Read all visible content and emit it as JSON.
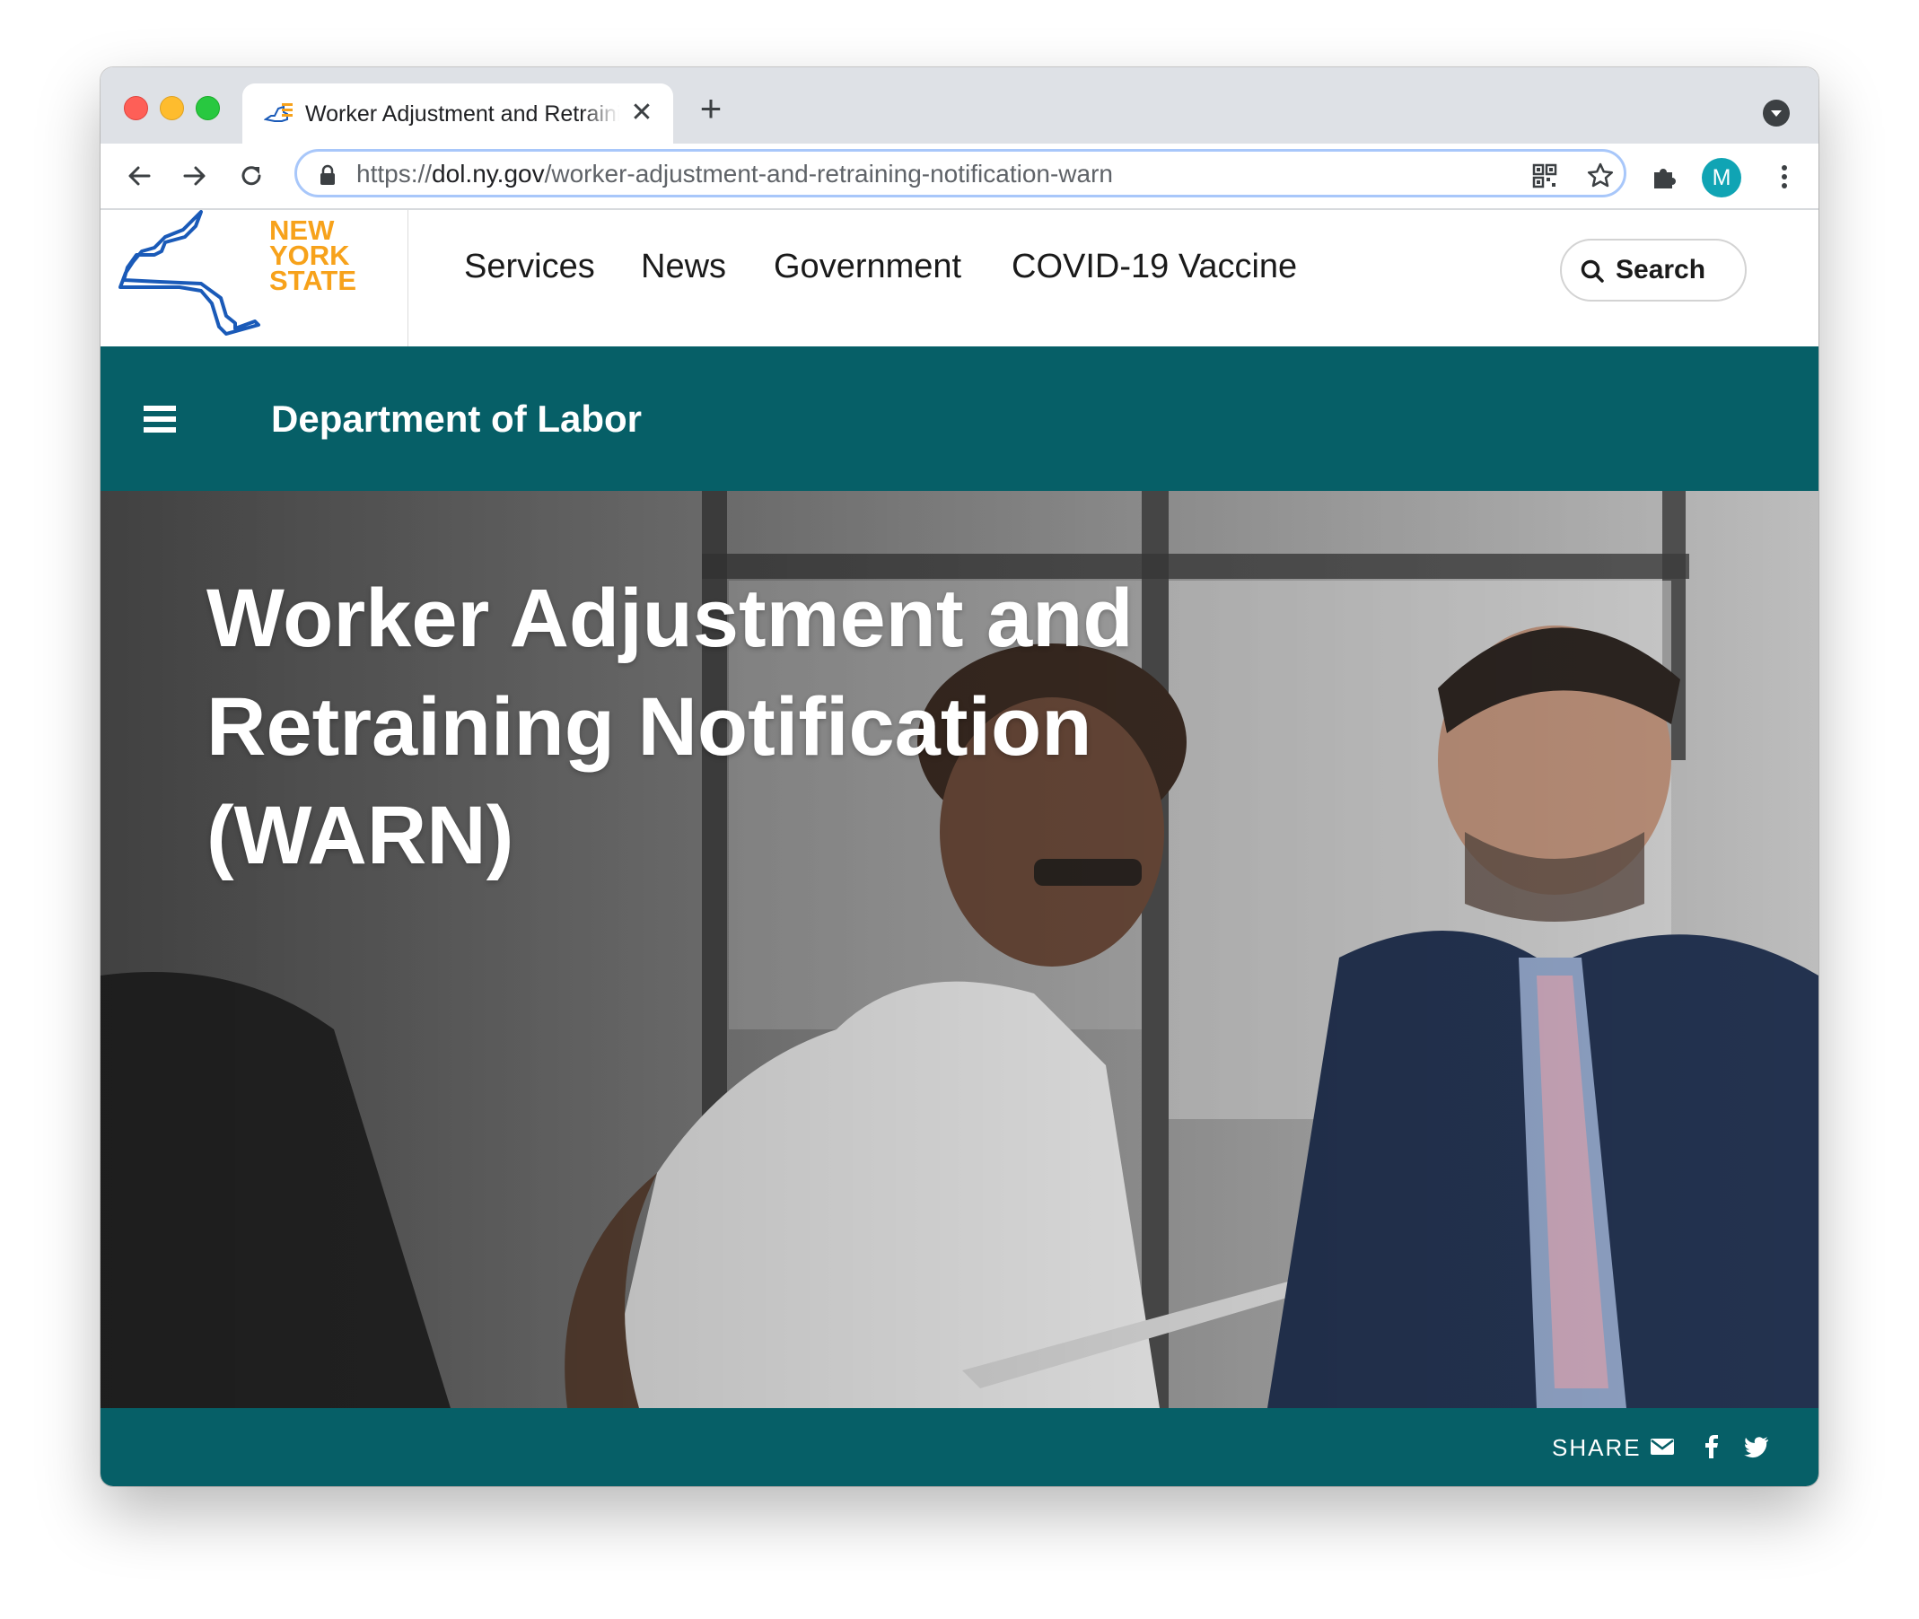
{
  "browser": {
    "tab": {
      "title": "Worker Adjustment and Retraining Notification (WARN)",
      "close_glyph": "✕"
    },
    "new_tab_glyph": "+",
    "url": {
      "scheme": "https://",
      "host": "dol.ny.gov",
      "path": "/worker-adjustment-and-retraining-notification-warn"
    },
    "profile_initial": "M",
    "icons": [
      "back-icon",
      "forward-icon",
      "reload-icon",
      "lock-icon",
      "qr-code-icon",
      "bookmark-star-icon",
      "extensions-icon",
      "more-vert-icon",
      "tab-search-icon"
    ]
  },
  "site": {
    "logo_lines": [
      "NEW",
      "YORK",
      "STATE"
    ],
    "nav": [
      "Services",
      "News",
      "Government",
      "COVID-19 Vaccine"
    ],
    "search_label": "Search",
    "agency": "Department of Labor",
    "hero_title": "Worker Adjustment and Retraining Notification (WARN)",
    "share_label": "SHARE",
    "share_icons": [
      "email-icon",
      "facebook-icon",
      "twitter-icon"
    ]
  },
  "colors": {
    "brand_teal": "#065f67",
    "logo_orange": "#f7a21b",
    "logo_blue": "#1a5ab8",
    "avatar": "#10a4b4"
  }
}
